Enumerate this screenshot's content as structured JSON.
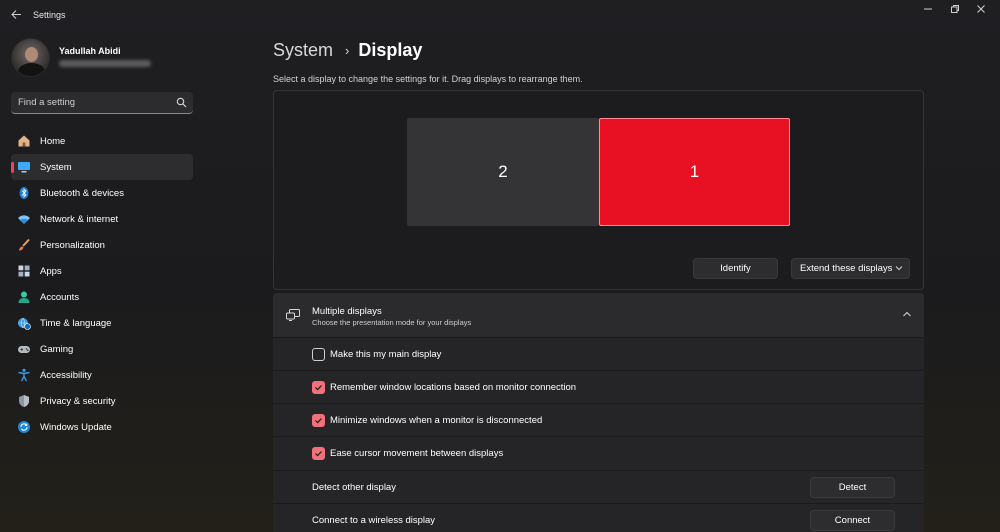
{
  "window": {
    "app_title": "Settings"
  },
  "profile": {
    "name": "Yadullah Abidi"
  },
  "search": {
    "placeholder": "Find a setting"
  },
  "sidebar": {
    "items": [
      {
        "label": "Home",
        "icon": "home-icon",
        "active": false
      },
      {
        "label": "System",
        "icon": "monitor-icon",
        "active": true
      },
      {
        "label": "Bluetooth & devices",
        "icon": "bluetooth-icon",
        "active": false
      },
      {
        "label": "Network & internet",
        "icon": "wifi-icon",
        "active": false
      },
      {
        "label": "Personalization",
        "icon": "brush-icon",
        "active": false
      },
      {
        "label": "Apps",
        "icon": "apps-icon",
        "active": false
      },
      {
        "label": "Accounts",
        "icon": "person-icon",
        "active": false
      },
      {
        "label": "Time & language",
        "icon": "globe-clock-icon",
        "active": false
      },
      {
        "label": "Gaming",
        "icon": "gamepad-icon",
        "active": false
      },
      {
        "label": "Accessibility",
        "icon": "accessibility-icon",
        "active": false
      },
      {
        "label": "Privacy & security",
        "icon": "shield-icon",
        "active": false
      },
      {
        "label": "Windows Update",
        "icon": "update-icon",
        "active": false
      }
    ]
  },
  "header": {
    "parent": "System",
    "separator": "›",
    "current": "Display"
  },
  "arrange": {
    "hint": "Select a display to change the settings for it. Drag displays to rearrange them.",
    "monitors": [
      {
        "number": "2",
        "selected": false
      },
      {
        "number": "1",
        "selected": true
      }
    ],
    "identify_label": "Identify",
    "mode_label": "Extend these displays"
  },
  "multiple_displays": {
    "title": "Multiple displays",
    "subtitle": "Choose the presentation mode for your displays",
    "options": [
      {
        "label": "Make this my main display",
        "checked": false
      },
      {
        "label": "Remember window locations based on monitor connection",
        "checked": true
      },
      {
        "label": "Minimize windows when a monitor is disconnected",
        "checked": true
      },
      {
        "label": "Ease cursor movement between displays",
        "checked": true
      }
    ],
    "detect_label": "Detect other display",
    "detect_button": "Detect",
    "wireless_label": "Connect to a wireless display",
    "wireless_button": "Connect"
  },
  "colors": {
    "accent": "#e8485a",
    "selected_monitor": "#e81123",
    "checkbox_checked": "#f1707a"
  }
}
